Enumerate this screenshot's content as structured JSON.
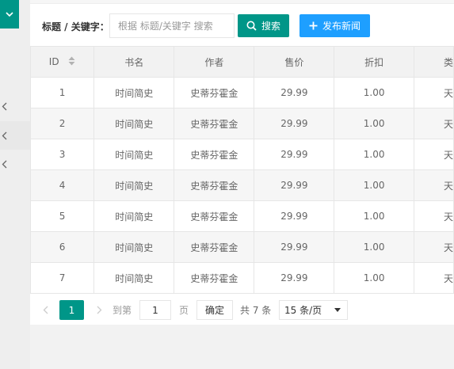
{
  "sidebar": {
    "top_icon": "chevron-down-icon",
    "chevrons": [
      "chevron-left-icon",
      "chevron-left-icon",
      "chevron-left-icon"
    ]
  },
  "search": {
    "label": "标题 / 关键字：",
    "placeholder": "根据 标题/关键字 搜索",
    "search_button": "搜索",
    "publish_button": "发布新闻"
  },
  "table": {
    "columns": [
      "ID",
      "书名",
      "作者",
      "售价",
      "折扣",
      "类"
    ],
    "rows": [
      [
        "1",
        "时间简史",
        "史蒂芬霍金",
        "29.99",
        "1.00",
        "天"
      ],
      [
        "2",
        "时间简史",
        "史蒂芬霍金",
        "29.99",
        "1.00",
        "天"
      ],
      [
        "3",
        "时间简史",
        "史蒂芬霍金",
        "29.99",
        "1.00",
        "天"
      ],
      [
        "4",
        "时间简史",
        "史蒂芬霍金",
        "29.99",
        "1.00",
        "天"
      ],
      [
        "5",
        "时间简史",
        "史蒂芬霍金",
        "29.99",
        "1.00",
        "天"
      ],
      [
        "6",
        "时间简史",
        "史蒂芬霍金",
        "29.99",
        "1.00",
        "天"
      ],
      [
        "7",
        "时间简史",
        "史蒂芬霍金",
        "29.99",
        "1.00",
        "天"
      ]
    ]
  },
  "pager": {
    "current": "1",
    "goto_label": "到第",
    "page_input": "1",
    "page_label": "页",
    "confirm": "确定",
    "total": "共 7 条",
    "per_page": "15 条/页"
  },
  "colors": {
    "primary": "#009688",
    "blue": "#1e9fff"
  }
}
